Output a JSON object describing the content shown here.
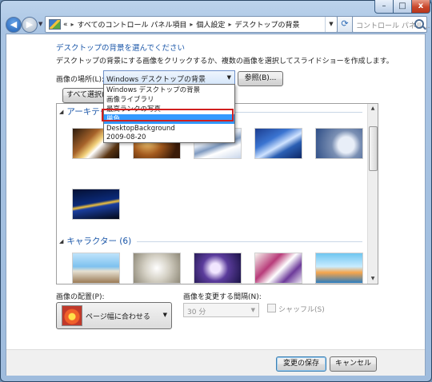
{
  "window": {
    "caption_buttons": {
      "minimize": "–",
      "maximize": "□",
      "close": "x"
    }
  },
  "nav": {
    "back_glyph": "◀",
    "forward_glyph": "▶",
    "address": {
      "prefix": "«",
      "crumbs": [
        "すべてのコントロール パネル項目",
        "個人設定",
        "デスクトップの背景"
      ],
      "separator": "▸"
    },
    "search_placeholder": "コントロール パネル..."
  },
  "page": {
    "heading": "デスクトップの背景を選んでください",
    "description": "デスクトップの背景にする画像をクリックするか、複数の画像を選択してスライドショーを作成します。",
    "location_label": "画像の場所(L):",
    "location_value": "Windows デスクトップの背景",
    "browse_button": "参照(B)...",
    "select_all_button": "すべて選択(A)"
  },
  "dropdown": {
    "options": [
      "Windows デスクトップの背景",
      "画像ライブラリ",
      "最高ランクの写真",
      "単色",
      "DesktopBackground",
      "2009-08-20"
    ],
    "selected_index": 3
  },
  "gallery": {
    "groups": [
      {
        "title": "アーキテクチャ (6)",
        "collapse_glyph": "◢"
      },
      {
        "title": "キャラクター (6)",
        "collapse_glyph": "◢"
      }
    ]
  },
  "controls": {
    "position_label": "画像の配置(P):",
    "position_value": "ページ幅に合わせる",
    "interval_label": "画像を変更する間隔(N):",
    "interval_value": "30 分",
    "shuffle_label": "シャッフル(S)",
    "shuffle_checked": false
  },
  "footer": {
    "save_button": "変更の保存",
    "cancel_button": "キャンセル"
  },
  "colors": {
    "heading_blue": "#1a56a8",
    "selection_blue": "#3399ff",
    "highlight_red": "#d11f1f"
  }
}
